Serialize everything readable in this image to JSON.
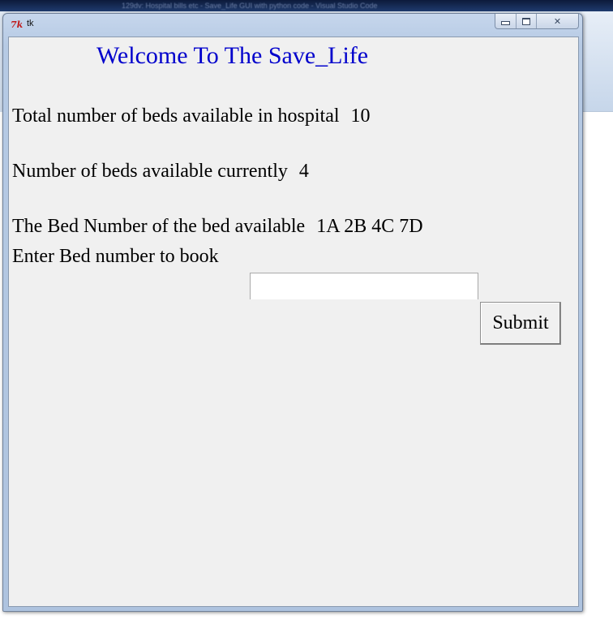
{
  "background": {
    "topbar_text": "129dv: Hospital bills etc - Save_Life GUI with python code - Visual Studio Code"
  },
  "window": {
    "title": "tk",
    "icon": "tk-feather-icon",
    "controls": {
      "minimize_icon": "minimize-icon",
      "maximize_icon": "maximize-icon",
      "close_glyph": "✕"
    }
  },
  "content": {
    "welcome": "Welcome To The Save_Life",
    "total_beds_label": "Total number of beds available in hospital",
    "total_beds_value": "10",
    "current_beds_label": "Number of beds available currently",
    "current_beds_value": "4",
    "bed_numbers_label": "The Bed Number of the bed available",
    "bed_numbers_value": "1A 2B 4C 7D",
    "enter_label": "Enter Bed number to book",
    "entry_value": "",
    "submit_label": "Submit"
  },
  "colors": {
    "welcome": "#0000cc",
    "client_bg": "#f0f0f0"
  }
}
